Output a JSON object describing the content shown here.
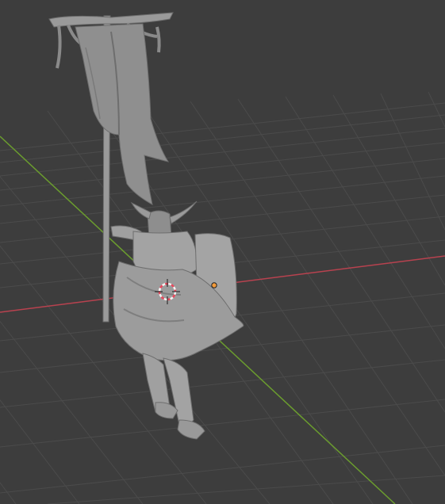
{
  "viewport": {
    "background": "#3d3d3d",
    "grid_color": "#4b4b4b",
    "x_axis_color": "#b8424f",
    "y_axis_color": "#6b9d2e",
    "model_color": "#9a9a9a",
    "model_shadow": "#6e6e6e",
    "model_highlight": "#b8b8b8",
    "origin_color": "#f29a3a",
    "cursor_red": "#e8495d",
    "cursor_white": "#f4f4f4"
  },
  "scene": {
    "object_type": "sculpt-mesh",
    "object_description_icon": "banner-bearer-figure-icon",
    "selected": true,
    "show_3d_cursor": true,
    "show_origin": true
  }
}
